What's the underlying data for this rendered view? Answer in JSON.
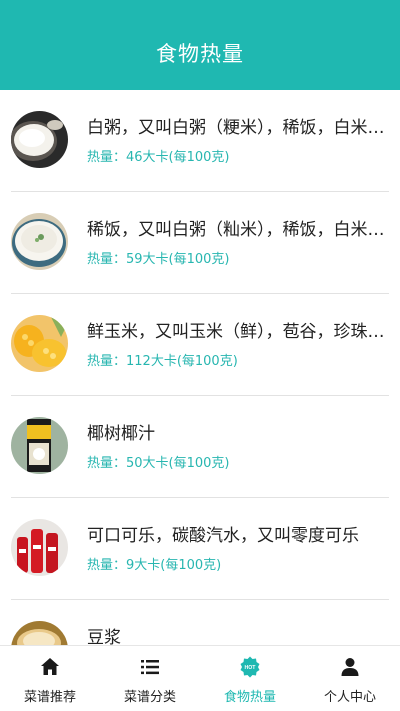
{
  "header": {
    "title": "食物热量"
  },
  "foods": [
    {
      "name": "白粥，又叫白粥（粳米），稀饭，白米粥，大米粥，白米...",
      "calories": "热量：46大卡(每100克)"
    },
    {
      "name": "稀饭，又叫白粥（籼米），稀饭，白米粥，大米粥，白米...",
      "calories": "热量：59大卡(每100克)"
    },
    {
      "name": "鲜玉米，又叫玉米（鲜），苞谷，珍珠米，棒子，玉蜀黍...",
      "calories": "热量：112大卡(每100克)"
    },
    {
      "name": "椰树椰汁",
      "calories": "热量：50大卡(每100克)"
    },
    {
      "name": "可口可乐，碳酸汽水，又叫零度可乐",
      "calories": "热量：9大卡(每100克)"
    },
    {
      "name": "豆浆",
      "calories": ""
    }
  ],
  "tabbar": {
    "active_color": "#1fb8b1",
    "tabs": [
      {
        "label": "菜谱推荐",
        "icon": "home-icon"
      },
      {
        "label": "菜谱分类",
        "icon": "list-icon"
      },
      {
        "label": "食物热量",
        "icon": "hot-badge-icon",
        "badge": "HOT"
      },
      {
        "label": "个人中心",
        "icon": "user-icon"
      }
    ]
  },
  "theme": {
    "primary": "#1fb8b1",
    "calorie_text": "#27b6b0"
  }
}
